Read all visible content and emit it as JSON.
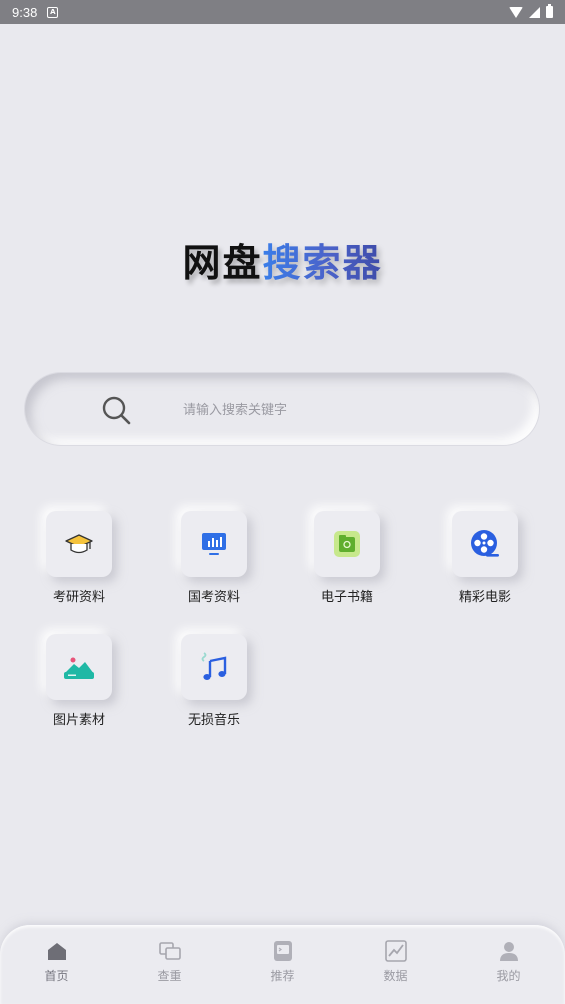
{
  "status_bar": {
    "time": "9:38",
    "notif_glyph": "A"
  },
  "title": {
    "part1": "网盘",
    "part2": "搜索器"
  },
  "search": {
    "placeholder": "请输入搜索关键字",
    "value": ""
  },
  "categories": [
    {
      "label": "考研资料",
      "icon": "graduation-cap-icon"
    },
    {
      "label": "国考资料",
      "icon": "presentation-chart-icon"
    },
    {
      "label": "电子书籍",
      "icon": "ebook-icon"
    },
    {
      "label": "精彩电影",
      "icon": "film-reel-icon"
    },
    {
      "label": "图片素材",
      "icon": "landscape-image-icon"
    },
    {
      "label": "无损音乐",
      "icon": "music-note-icon"
    }
  ],
  "bottom_nav": [
    {
      "label": "首页",
      "icon": "home-icon",
      "active": true
    },
    {
      "label": "查重",
      "icon": "duplicate-check-icon",
      "active": false
    },
    {
      "label": "推荐",
      "icon": "recommend-icon",
      "active": false
    },
    {
      "label": "数据",
      "icon": "chart-icon",
      "active": false
    },
    {
      "label": "我的",
      "icon": "user-icon",
      "active": false
    }
  ],
  "colors": {
    "background": "#e9e9ee",
    "title_blue_start": "#3a7de8",
    "title_blue_end": "#3e4ba8",
    "status_bar": "#7f7f84",
    "nav_inactive": "#9a9aa2"
  }
}
